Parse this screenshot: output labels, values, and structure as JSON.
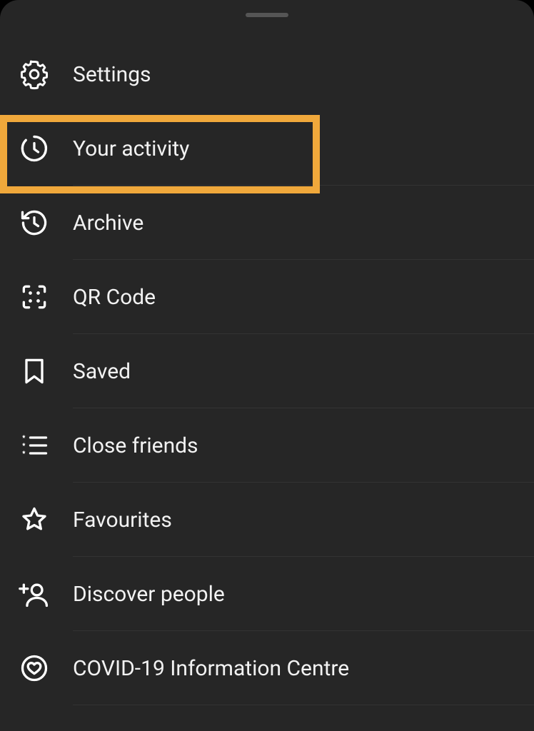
{
  "menu": {
    "items": [
      {
        "key": "settings",
        "label": "Settings",
        "icon": "gear-icon"
      },
      {
        "key": "your-activity",
        "label": "Your activity",
        "icon": "activity-clock-icon"
      },
      {
        "key": "archive",
        "label": "Archive",
        "icon": "history-icon"
      },
      {
        "key": "qr-code",
        "label": "QR Code",
        "icon": "qr-code-icon"
      },
      {
        "key": "saved",
        "label": "Saved",
        "icon": "bookmark-icon"
      },
      {
        "key": "close-friends",
        "label": "Close friends",
        "icon": "close-friends-icon"
      },
      {
        "key": "favourites",
        "label": "Favourites",
        "icon": "star-icon"
      },
      {
        "key": "discover-people",
        "label": "Discover people",
        "icon": "discover-people-icon"
      },
      {
        "key": "covid-info",
        "label": "COVID-19 Information Centre",
        "icon": "heart-circle-icon"
      }
    ],
    "highlighted_index": 1
  },
  "colors": {
    "sheet_bg": "#262626",
    "highlight": "#f0a83b",
    "text": "#f2f2f2"
  }
}
